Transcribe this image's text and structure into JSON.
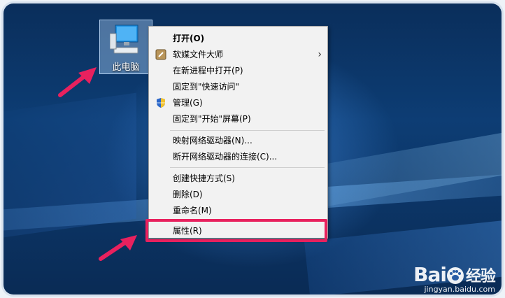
{
  "desktop": {
    "icon_label": "此电脑"
  },
  "context_menu": {
    "items": [
      {
        "label": "打开(O)",
        "bold": true,
        "icon": ""
      },
      {
        "label": "软媒文件大师",
        "icon": "app-icon",
        "has_submenu": true
      },
      {
        "label": "在新进程中打开(P)",
        "icon": ""
      },
      {
        "label": "固定到\"快速访问\"",
        "icon": ""
      },
      {
        "label": "管理(G)",
        "icon": "shield-icon"
      },
      {
        "label": "固定到\"开始\"屏幕(P)",
        "icon": ""
      },
      {
        "label": "映射网络驱动器(N)...",
        "icon": ""
      },
      {
        "label": "断开网络驱动器的连接(C)...",
        "icon": ""
      },
      {
        "label": "创建快捷方式(S)",
        "icon": ""
      },
      {
        "label": "删除(D)",
        "icon": ""
      },
      {
        "label": "重命名(M)",
        "icon": ""
      },
      {
        "label": "属性(R)",
        "icon": "",
        "highlighted": true
      }
    ]
  },
  "watermark": {
    "brand": "Bai",
    "brand_suffix": "经验",
    "url": "jingyan.baidu.com"
  },
  "colors": {
    "highlight_border": "#e8215e",
    "arrow": "#e8215e",
    "desktop_bg": "#0d3d74"
  }
}
